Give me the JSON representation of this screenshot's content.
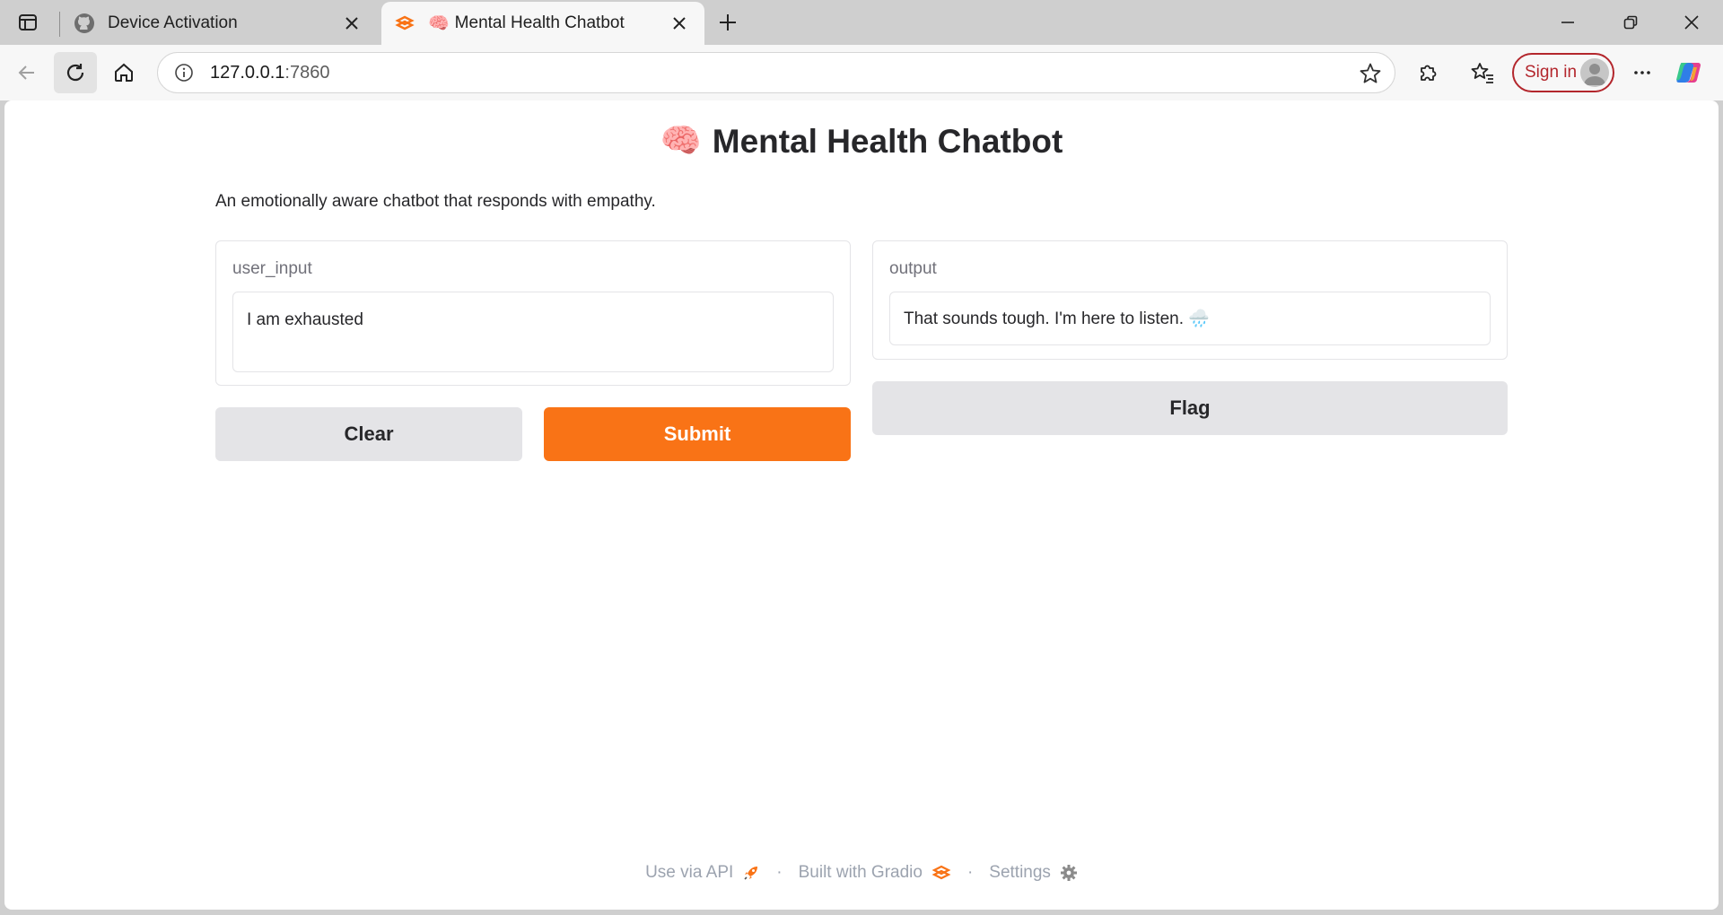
{
  "browser": {
    "tabs": [
      {
        "title": "Device Activation",
        "favicon": "github-icon",
        "active": false
      },
      {
        "title": "Mental Health Chatbot",
        "favicon": "gradio-icon",
        "emoji": "🧠",
        "active": true
      }
    ],
    "address": {
      "host": "127.0.0.1",
      "port": ":7860"
    },
    "signin_label": "Sign in"
  },
  "app": {
    "emoji": "🧠",
    "title": "Mental Health Chatbot",
    "description": "An emotionally aware chatbot that responds with empathy.",
    "input": {
      "label": "user_input",
      "value": "I am exhausted"
    },
    "output": {
      "label": "output",
      "value": "That sounds tough. I'm here to listen. 🌧️"
    },
    "buttons": {
      "clear": "Clear",
      "submit": "Submit",
      "flag": "Flag"
    },
    "footer": {
      "api": "Use via API",
      "built": "Built with Gradio",
      "settings": "Settings"
    }
  },
  "colors": {
    "accent": "#f97316",
    "secondary_button": "#e4e4e7",
    "signin": "#b3262c"
  }
}
